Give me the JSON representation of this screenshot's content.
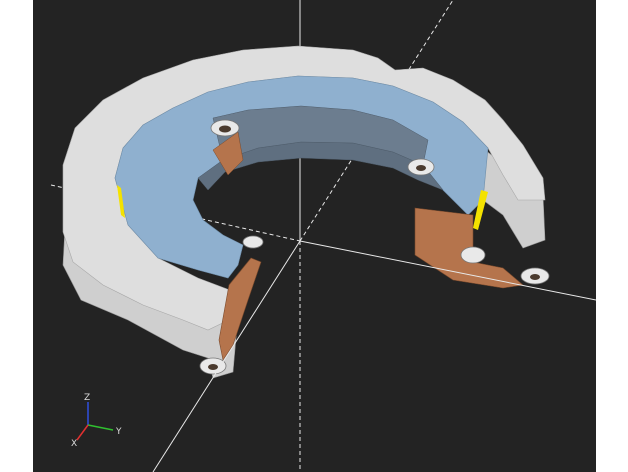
{
  "viewport": {
    "background": "#232323",
    "side_background": "#ffffff"
  },
  "model": {
    "outer_color": "#dcdcdc",
    "top_face_color": "#8fb0cf",
    "inner_wall_color": "#5f6f80",
    "cut_face_color": "#b5744c",
    "highlight_color": "#f4e200"
  },
  "axes_gizmo": {
    "x_label": "X",
    "y_label": "Y",
    "z_label": "Z",
    "x_color": "#e03030",
    "y_color": "#30c030",
    "z_color": "#3050e0"
  }
}
